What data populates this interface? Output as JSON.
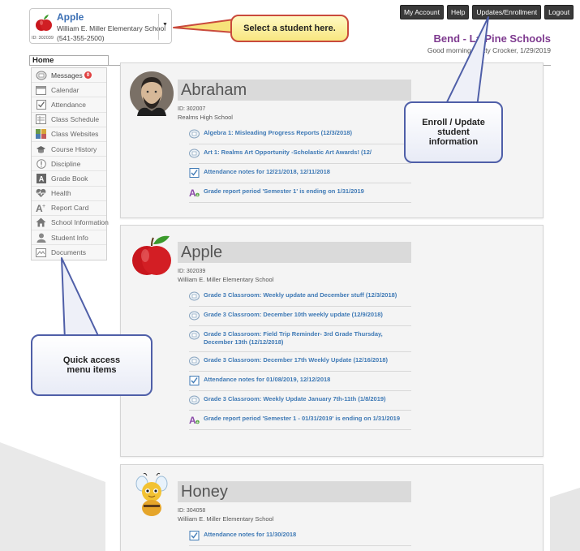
{
  "selector": {
    "name": "Apple",
    "school": "William E. Miller Elementary School",
    "id": "ID: 302039",
    "phone": "(541-355-2500)",
    "caret": "▼"
  },
  "top_nav": [
    "My Account",
    "Help",
    "Updates/Enrollment",
    "Logout"
  ],
  "district": "Bend - La Pine Schools",
  "greeting": "Good morning, Betty Crocker, 1/29/2019",
  "home_tab": "Home",
  "sidebar": [
    {
      "label": "Messages",
      "icon": "messages-icon",
      "badge": "0"
    },
    {
      "label": "Calendar",
      "icon": "calendar-icon"
    },
    {
      "label": "Attendance",
      "icon": "attendance-icon"
    },
    {
      "label": "Class Schedule",
      "icon": "class-schedule-icon"
    },
    {
      "label": "Class Websites",
      "icon": "class-websites-icon"
    },
    {
      "label": "Course History",
      "icon": "course-history-icon"
    },
    {
      "label": "Discipline",
      "icon": "discipline-icon"
    },
    {
      "label": "Grade Book",
      "icon": "grade-book-icon"
    },
    {
      "label": "Health",
      "icon": "health-icon"
    },
    {
      "label": "Report Card",
      "icon": "report-card-icon"
    },
    {
      "label": "School Information",
      "icon": "school-information-icon"
    },
    {
      "label": "Student Info",
      "icon": "student-info-icon"
    },
    {
      "label": "Documents",
      "icon": "documents-icon"
    }
  ],
  "students": [
    {
      "name": "Abraham",
      "avatar": "portrait-avatar",
      "id": "ID: 302007",
      "school": "Realms High School",
      "items": [
        {
          "type": "class",
          "label": "Algebra 1: Misleading Progress Reports (12/3/2018)"
        },
        {
          "type": "class",
          "label": "Art 1: Realms Art Opportunity -Scholastic Art Awards! (12/"
        },
        {
          "type": "attendance",
          "label": "Attendance notes for 12/21/2018, 12/11/2018"
        },
        {
          "type": "grade",
          "label": "Grade report period 'Semester 1' is ending on 1/31/2019"
        }
      ]
    },
    {
      "name": "Apple",
      "avatar": "apple-avatar",
      "id": "ID: 302039",
      "school": "William E. Miller Elementary School",
      "items": [
        {
          "type": "class",
          "label": "Grade 3 Classroom: Weekly update and December stuff (12/3/2018)"
        },
        {
          "type": "class",
          "label": "Grade 3 Classroom: December 10th weekly update (12/9/2018)"
        },
        {
          "type": "class",
          "label": "Grade 3 Classroom: Field Trip Reminder- 3rd Grade Thursday, December 13th (12/12/2018)"
        },
        {
          "type": "class",
          "label": "Grade 3 Classroom: December 17th Weekly Update (12/16/2018)"
        },
        {
          "type": "attendance",
          "label": "Attendance notes for 01/08/2019, 12/12/2018"
        },
        {
          "type": "class",
          "label": "Grade 3 Classroom: Weekly Update January 7th-11th (1/8/2019)"
        },
        {
          "type": "grade",
          "label": "Grade report period 'Semester 1 - 01/31/2019' is ending on 1/31/2019"
        }
      ]
    },
    {
      "name": "Honey",
      "avatar": "bee-avatar",
      "id": "ID: 304058",
      "school": "William E. Miller Elementary School",
      "items": [
        {
          "type": "attendance",
          "label": "Attendance notes for 11/30/2018"
        }
      ]
    }
  ],
  "callouts": {
    "select_student": "Select a student here.",
    "enroll": "Enroll / Update student information",
    "quick_access": "Quick access menu items"
  },
  "colors": {
    "accent_link": "#3e79b5",
    "district_purple": "#7e3a8f",
    "nav_dark": "#3a3a3a",
    "callout_red": "#c94a3c",
    "callout_blue": "#4f5fa8"
  }
}
